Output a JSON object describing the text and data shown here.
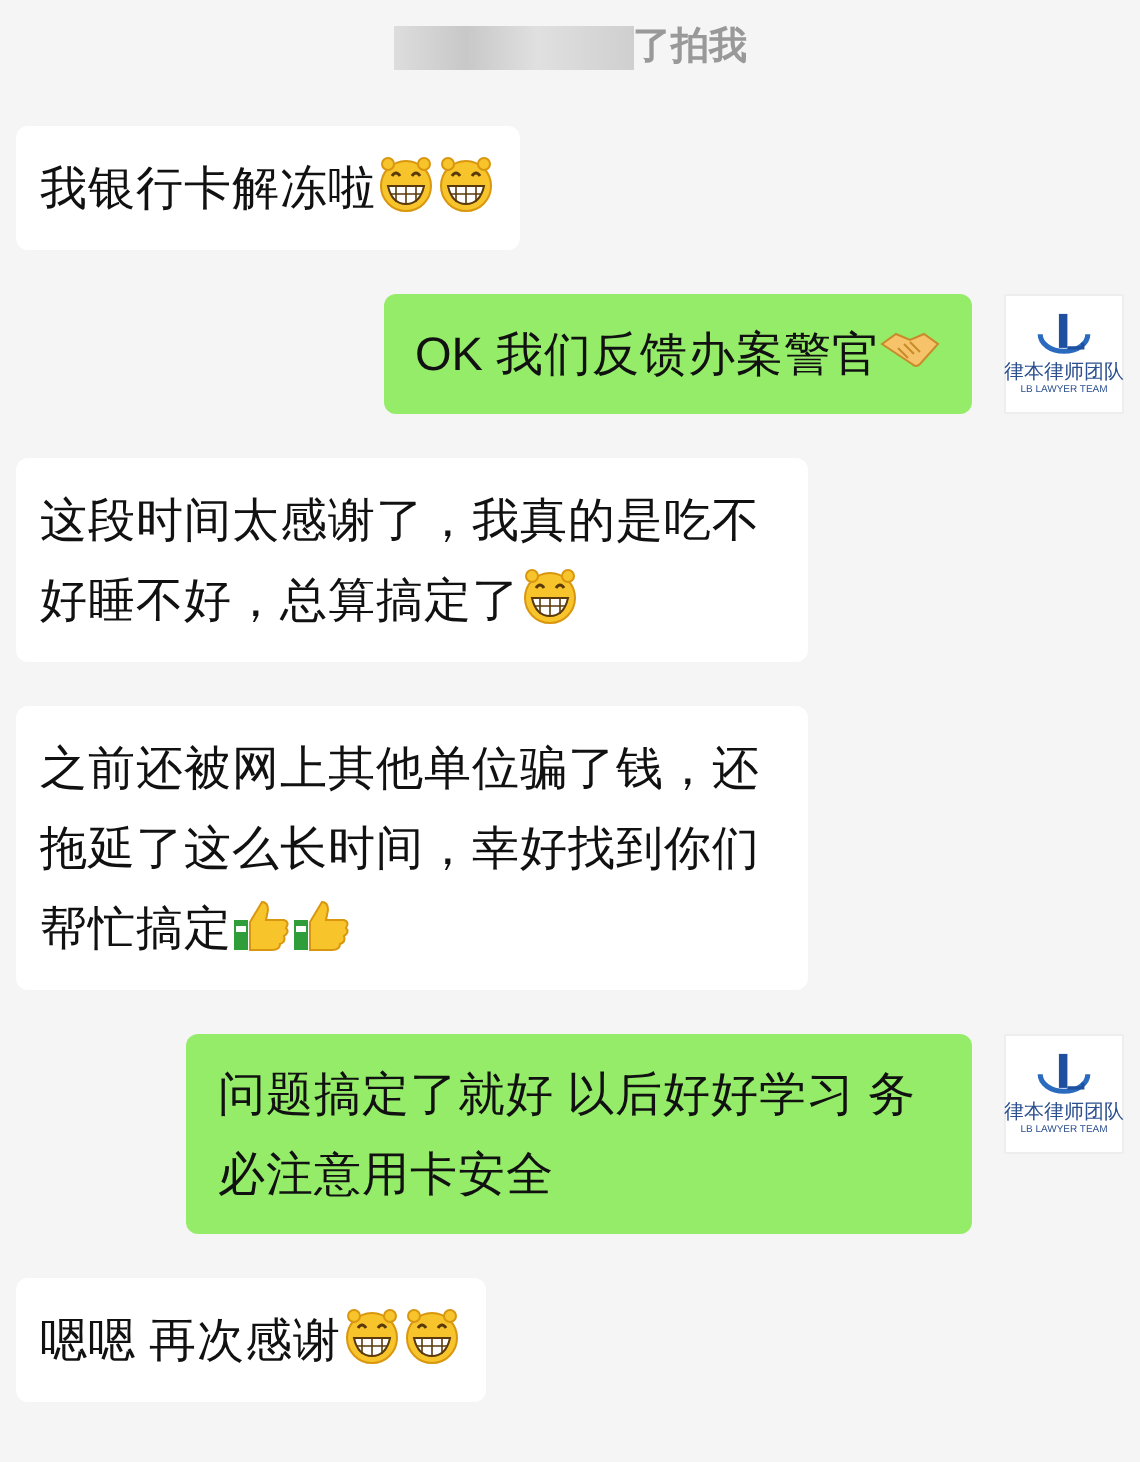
{
  "notice": {
    "text": "了拍我"
  },
  "messages": [
    {
      "kind": "received",
      "text": "我银行卡解冻啦",
      "emojis": [
        {
          "kind": "grin"
        },
        {
          "kind": "grin"
        }
      ]
    },
    {
      "kind": "sent",
      "text": "OK 我们反馈办案警官",
      "emojis": [
        {
          "kind": "handshake"
        }
      ],
      "avatar": {
        "name": "律本律师团队",
        "subtitle": "LB LAWYER TEAM"
      }
    },
    {
      "kind": "received",
      "text": "这段时间太感谢了，我真的是吃不好睡不好，总算搞定了",
      "emojis": [
        {
          "kind": "grin"
        }
      ]
    },
    {
      "kind": "received",
      "text": "之前还被网上其他单位骗了钱，还拖延了这么长时间，幸好找到你们帮忙搞定",
      "emojis": [
        {
          "kind": "thumbs"
        },
        {
          "kind": "thumbs"
        }
      ]
    },
    {
      "kind": "sent",
      "text": "问题搞定了就好 以后好好学习 务必注意用卡安全",
      "avatar": {
        "name": "律本律师团队",
        "subtitle": "LB LAWYER TEAM"
      }
    },
    {
      "kind": "received",
      "text": "嗯嗯 再次感谢",
      "emojis": [
        {
          "kind": "grin"
        },
        {
          "kind": "grin"
        }
      ]
    }
  ]
}
